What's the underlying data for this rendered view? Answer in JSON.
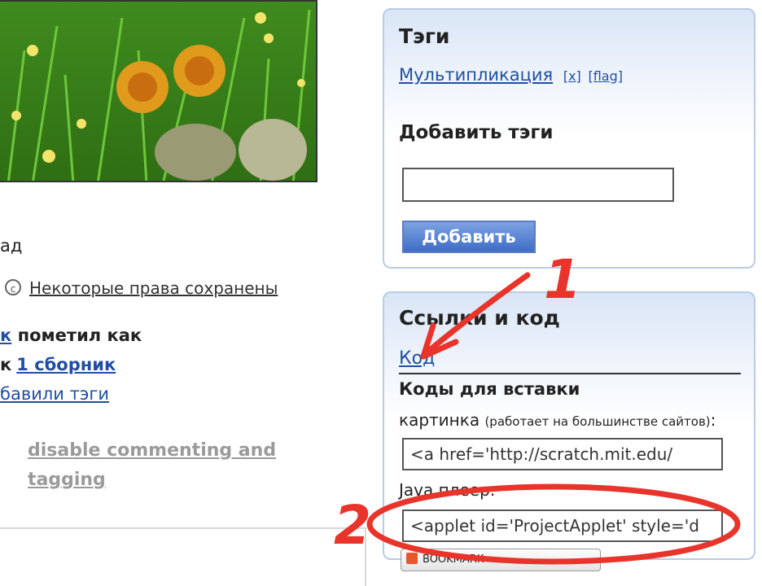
{
  "left": {
    "fragment_ad": "ад",
    "license": {
      "icon": "cc-icon",
      "text": "Некоторые права сохранены"
    },
    "marked_row": {
      "prefix_link": "к",
      "text": "пометил как"
    },
    "collection_row": {
      "prefix": "к",
      "link": "1 сборник"
    },
    "tags_added_row": {
      "link": "бавили тэги"
    },
    "disable_link": "disable commenting and tagging"
  },
  "tags_panel": {
    "title": "Тэги",
    "tag": "Мультипликация",
    "remove_label": "[x]",
    "flag_label": "[flag]",
    "add_title": "Добавить тэги",
    "input_value": "",
    "add_button": "Добавить"
  },
  "links_panel": {
    "title": "Ссылки и код",
    "code_tab": "Код",
    "embed_title": "Коды для вставки",
    "picture_label": "картинка",
    "picture_note": "(работает на большинстве сайтов)",
    "picture_colon": ":",
    "picture_code": "<a href='http://scratch.mit.edu/",
    "java_label": "Java плеер:",
    "java_code": "<applet id='ProjectApplet' style='d",
    "bookmark_label": "BOOKMARK"
  },
  "annotations": {
    "label_1": "1",
    "label_2": "2",
    "color": "#e8342a"
  },
  "colors": {
    "link": "#1f4fa3",
    "panel_border": "#b9cbe6",
    "button": "#3f6dc5"
  }
}
